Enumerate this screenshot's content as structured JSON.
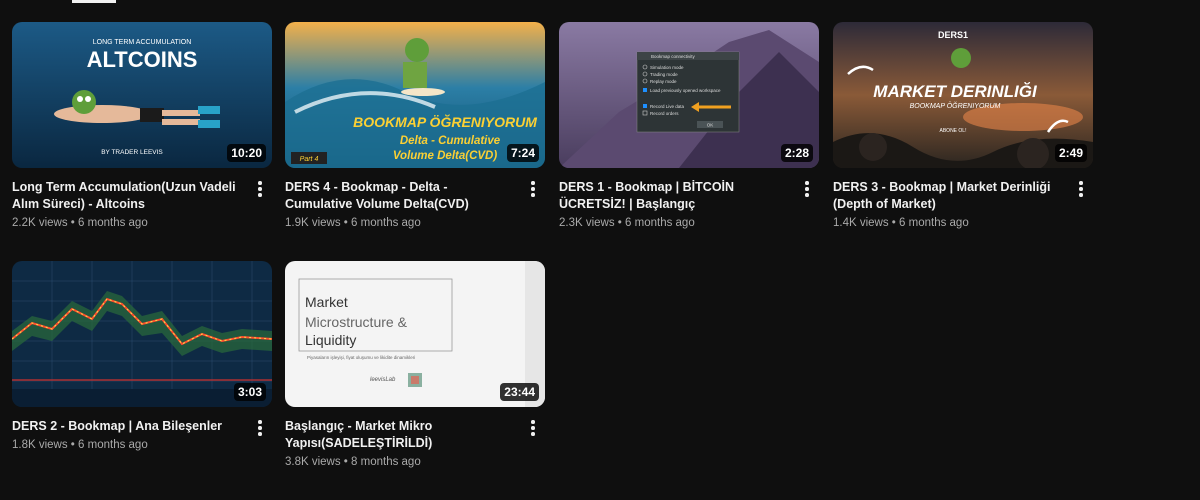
{
  "videos": [
    {
      "title": "Long Term Accumulation(Uzun Vadeli Alım Süreci) - Altcoins",
      "views": "2.2K views",
      "age": "6 months ago",
      "duration": "10:20",
      "thumb": {
        "top": "LONG TERM ACCUMULATION",
        "main": "ALTCOINS",
        "bottom": "BY TRADER LEEVIS"
      }
    },
    {
      "title": "DERS 4 - Bookmap - Delta - Cumulative Volume Delta(CVD)",
      "views": "1.9K views",
      "age": "6 months ago",
      "duration": "7:24",
      "thumb": {
        "main": "BOOKMAP ÖĞRENIYORUM",
        "line1": "Delta - Cumulative",
        "line2": "Volume Delta(CVD)",
        "part": "Part 4"
      }
    },
    {
      "title": "DERS 1 - Bookmap | BİTCOİN ÜCRETSİZ! | Başlangıç",
      "views": "2.3K views",
      "age": "6 months ago",
      "duration": "2:28",
      "thumb": {
        "dialog_title": "Bookmap connectivity",
        "options": [
          "Simulation mode",
          "Trading mode",
          "Replay mode",
          "Load previously opened workspace",
          "Record Live data",
          "Record orders"
        ],
        "ok": "OK"
      }
    },
    {
      "title": "DERS 3 - Bookmap | Market Derinliği (Depth of Market)",
      "views": "1.4K views",
      "age": "6 months ago",
      "duration": "2:49",
      "thumb": {
        "top": "DERS1",
        "main": "MARKET DERINLIĞI",
        "sub": "BOOKMAP ÖĞRENIYORUM",
        "cta": "ABONE OL!"
      }
    },
    {
      "title": "DERS 2 - Bookmap | Ana Bileşenler",
      "views": "1.8K views",
      "age": "6 months ago",
      "duration": "3:03",
      "thumb": {}
    },
    {
      "title": "Başlangıç - Market Mikro Yapısı(SADELEŞTİRİLDİ)",
      "views": "3.8K views",
      "age": "8 months ago",
      "duration": "23:44",
      "thumb": {
        "line1": "Market",
        "line2": "Microstructure &",
        "line3": "Liquidity",
        "caption": "Piyasaların işleyişi, fiyat oluşumu ve likidite dinamikleri",
        "brand": "leevisLab"
      }
    }
  ],
  "colors": {
    "background": "#0f0f0f",
    "text": "#f1f1f1",
    "secondary_text": "#aaaaaa"
  }
}
